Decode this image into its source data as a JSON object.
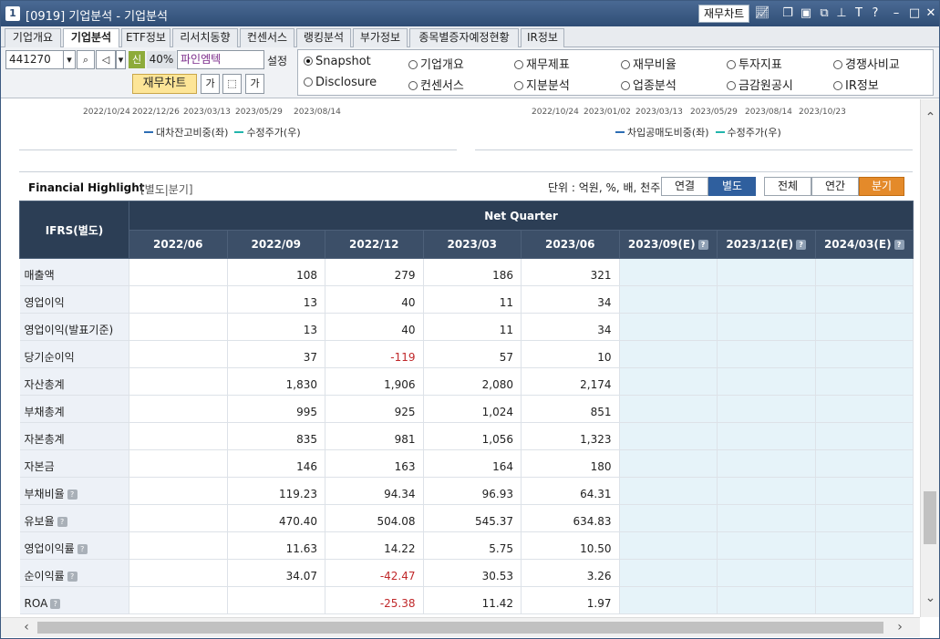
{
  "window": {
    "number": "1",
    "title": "[0919] 기업분석 - 기업분석",
    "fin_chart_btn": "재무차트"
  },
  "tabs": [
    "기업개요",
    "기업분석",
    "ETF정보",
    "리서치동향",
    "컨센서스",
    "랭킹분석",
    "부가정보",
    "종목별증자예정현황",
    "IR정보"
  ],
  "toolbar": {
    "code": "441270",
    "badge": "신",
    "margin": "40%",
    "company": "파인엠텍",
    "setting": "설정",
    "fin_chart": "재무차트"
  },
  "radios": [
    "Snapshot",
    "기업개요",
    "재무제표",
    "재무비율",
    "투자지표",
    "경쟁사비교",
    "Disclosure",
    "컨센서스",
    "지분분석",
    "업종분석",
    "금감원공시",
    "IR정보"
  ],
  "charts": {
    "left_dates": [
      "2022/10/24",
      "2022/12/26",
      "2023/03/13",
      "2023/05/29",
      "2023/08/14"
    ],
    "left_legend": [
      "대차잔고비중(좌)",
      "수정주가(우)"
    ],
    "right_dates": [
      "2022/10/24",
      "2023/01/02",
      "2023/03/13",
      "2023/05/29",
      "2023/08/14",
      "2023/10/23"
    ],
    "right_legend": [
      "차입공매도비중(좌)",
      "수정주가(우)"
    ],
    "legend_colors": [
      "#2d6db4",
      "#22b5ac"
    ]
  },
  "highlight": {
    "title": "Financial Highlight",
    "subtitle": "[별도|분기]",
    "unit": "단위 : 억원, %, 배, 천주",
    "btn_consol": "연결",
    "btn_sep": "별도",
    "btn_all": "전체",
    "btn_annual": "연간",
    "btn_quarter": "분기"
  },
  "table": {
    "corner": "IFRS(별도)",
    "group": "Net Quarter",
    "periods": [
      "2022/06",
      "2022/09",
      "2022/12",
      "2023/03",
      "2023/06",
      "2023/09(E)",
      "2023/12(E)",
      "2024/03(E)"
    ],
    "rows": [
      {
        "label": "매출액",
        "vals": [
          "",
          "108",
          "279",
          "186",
          "321",
          "",
          "",
          ""
        ]
      },
      {
        "label": "영업이익",
        "vals": [
          "",
          "13",
          "40",
          "11",
          "34",
          "",
          "",
          ""
        ]
      },
      {
        "label": "영업이익(발표기준)",
        "vals": [
          "",
          "13",
          "40",
          "11",
          "34",
          "",
          "",
          ""
        ]
      },
      {
        "label": "당기순이익",
        "vals": [
          "",
          "37",
          "-119",
          "57",
          "10",
          "",
          "",
          ""
        ]
      },
      {
        "label": "자산총계",
        "vals": [
          "",
          "1,830",
          "1,906",
          "2,080",
          "2,174",
          "",
          "",
          ""
        ]
      },
      {
        "label": "부채총계",
        "vals": [
          "",
          "995",
          "925",
          "1,024",
          "851",
          "",
          "",
          ""
        ]
      },
      {
        "label": "자본총계",
        "vals": [
          "",
          "835",
          "981",
          "1,056",
          "1,323",
          "",
          "",
          ""
        ]
      },
      {
        "label": "자본금",
        "vals": [
          "",
          "146",
          "163",
          "164",
          "180",
          "",
          "",
          ""
        ]
      },
      {
        "label": "부채비율",
        "vals": [
          "",
          "119.23",
          "94.34",
          "96.93",
          "64.31",
          "",
          "",
          ""
        ]
      },
      {
        "label": "유보율",
        "vals": [
          "",
          "470.40",
          "504.08",
          "545.37",
          "634.83",
          "",
          "",
          ""
        ]
      },
      {
        "label": "영업이익률",
        "vals": [
          "",
          "11.63",
          "14.22",
          "5.75",
          "10.50",
          "",
          "",
          ""
        ]
      },
      {
        "label": "순이익률",
        "vals": [
          "",
          "34.07",
          "-42.47",
          "30.53",
          "3.26",
          "",
          "",
          ""
        ]
      },
      {
        "label": "ROA",
        "vals": [
          "",
          "",
          "-25.38",
          "11.42",
          "1.97",
          "",
          "",
          ""
        ]
      }
    ],
    "help_rows": [
      "부채비율",
      "유보율",
      "영업이익률",
      "순이익률",
      "ROA"
    ],
    "help_glyph": "?"
  }
}
